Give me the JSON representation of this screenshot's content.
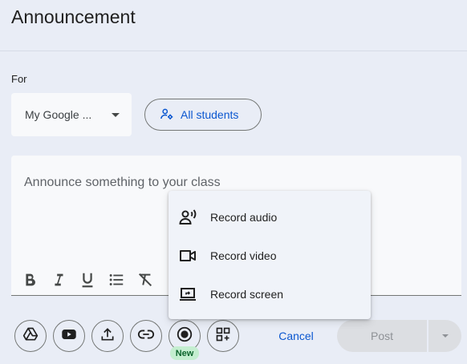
{
  "header": {
    "title": "Announcement"
  },
  "audience": {
    "for_label": "For",
    "course_selected": "My Google ...",
    "students_label": "All students"
  },
  "editor": {
    "placeholder": "Announce something to your class",
    "format_icons": [
      "bold-icon",
      "italic-icon",
      "underline-icon",
      "bulleted-list-icon",
      "clear-formatting-icon"
    ]
  },
  "record_menu": {
    "items": [
      {
        "label": "Record audio",
        "icon": "record-audio-icon"
      },
      {
        "label": "Record video",
        "icon": "record-video-icon"
      },
      {
        "label": "Record screen",
        "icon": "record-screen-icon"
      }
    ]
  },
  "toolbar": {
    "attach_icons": [
      "google-drive-icon",
      "youtube-icon",
      "upload-icon",
      "link-icon",
      "record-icon",
      "add-ons-icon"
    ],
    "new_badge": "New",
    "cancel_label": "Cancel",
    "post_label": "Post"
  },
  "colors": {
    "background": "#e9edf6",
    "surface": "#f8f9fb",
    "accent": "#0b57d0",
    "disabled": "#dcdee2",
    "badge_bg": "#c4eed0",
    "badge_text": "#0d652d"
  }
}
